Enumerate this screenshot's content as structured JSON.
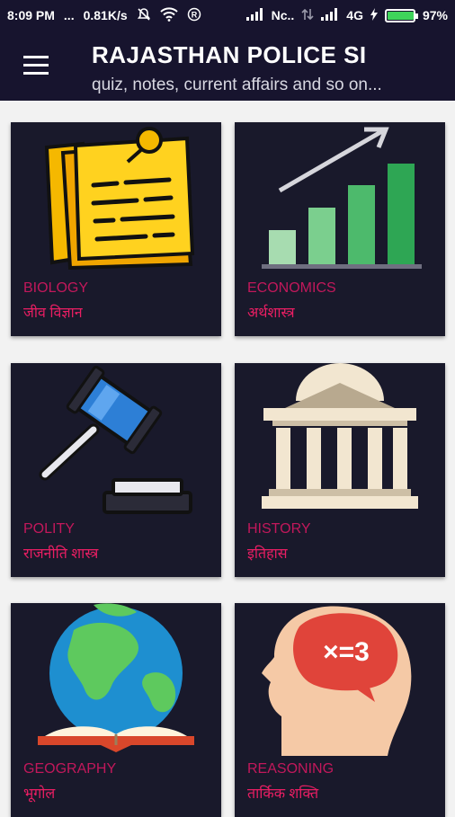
{
  "status": {
    "time": "8:09 PM",
    "dots": "...",
    "speed": "0.81K/s",
    "carrier": "Nc..",
    "network": "4G",
    "battery": "97%",
    "battery_level": 0.97
  },
  "appbar": {
    "title": "RAJASTHAN POLICE SI",
    "subtitle": "quiz, notes, current affairs and so on..."
  },
  "cards": [
    {
      "en": "BIOLOGY",
      "hi": "जीव विज्ञान",
      "icon": "sticky-notes-icon"
    },
    {
      "en": "ECONOMICS",
      "hi": "अर्थशास्त्र",
      "icon": "growth-chart-icon"
    },
    {
      "en": "POLITY",
      "hi": "राजनीति शास्त्र",
      "icon": "gavel-icon"
    },
    {
      "en": "HISTORY",
      "hi": "इतिहास",
      "icon": "museum-icon"
    },
    {
      "en": "GEOGRAPHY",
      "hi": "भूगोल",
      "icon": "globe-book-icon"
    },
    {
      "en": "REASONING",
      "hi": "तार्किक शक्ति",
      "icon": "head-math-icon"
    }
  ],
  "brain_text": "×=3",
  "colors": {
    "appbar": "#17142e",
    "card_bg": "#19192b",
    "label_en": "#c2185b",
    "label_hi": "#e91e63"
  }
}
